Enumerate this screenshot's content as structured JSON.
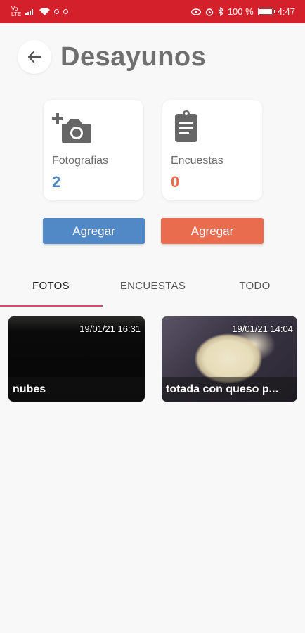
{
  "status_bar": {
    "battery_text": "100 %",
    "time": "4:47",
    "background": "#d4202b"
  },
  "header": {
    "title": "Desayunos",
    "back_icon": "arrow-left-icon"
  },
  "stats": {
    "photos": {
      "label": "Fotografias",
      "count": "2",
      "icon": "add-photo-icon",
      "color": "#4a86c5"
    },
    "surveys": {
      "label": "Encuestas",
      "count": "0",
      "icon": "clipboard-icon",
      "color": "#e96b4c"
    }
  },
  "buttons": {
    "add_photo": "Agregar",
    "add_survey": "Agregar"
  },
  "tabs": [
    {
      "label": "FOTOS",
      "selected": true
    },
    {
      "label": "ENCUESTAS",
      "selected": false
    },
    {
      "label": "TODO",
      "selected": false
    }
  ],
  "photos": [
    {
      "date": "19/01/21 16:31",
      "caption": "nubes"
    },
    {
      "date": "19/01/21 14:04",
      "caption": "totada con queso p..."
    }
  ],
  "colors": {
    "accent_tab": "#e0476e",
    "blue_button": "#5089c6",
    "orange_button": "#ea6c4e"
  }
}
